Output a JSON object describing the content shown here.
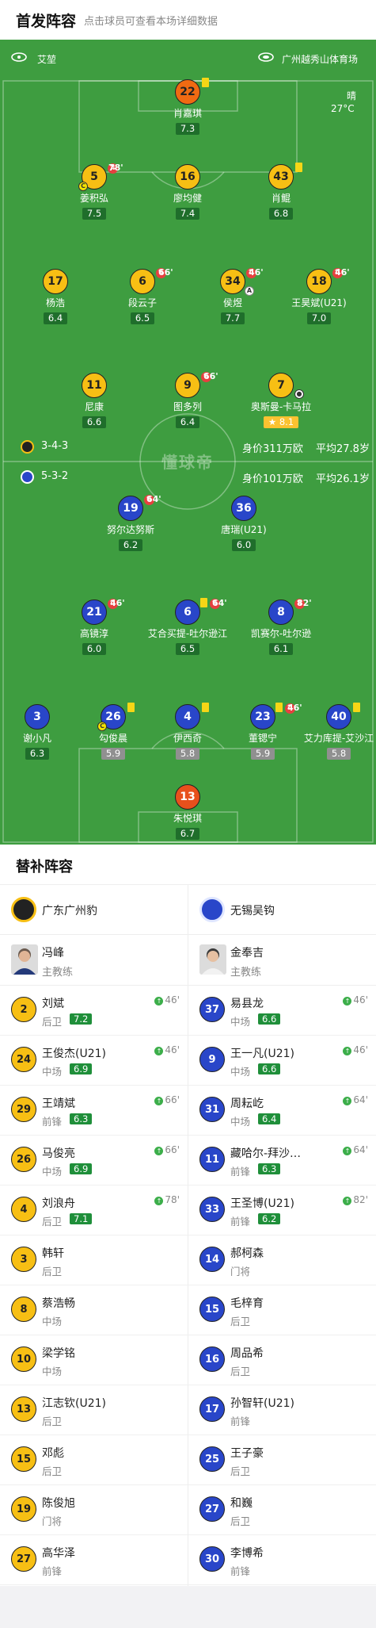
{
  "header": {
    "title": "首发阵容",
    "subtitle": "点击球员可查看本场详细数据"
  },
  "match": {
    "referee": "艾堃",
    "venue": "广州越秀山体育场",
    "weather": "晴",
    "temperature": "27°C"
  },
  "watermark": "懂球帝",
  "home_team": {
    "name": "广东广州豹",
    "formation": "3-4-3",
    "value": "身价311万欧",
    "avg_age": "平均27.8岁",
    "colors": {
      "kit": "#f7bf14",
      "gk": "#f06a12"
    },
    "players": [
      {
        "num": "22",
        "name": "肖嘉琪",
        "rating": "7.3",
        "events": [
          "yellow"
        ],
        "gk": true
      },
      {
        "num": "5",
        "name": "姜积弘",
        "rating": "7.5",
        "sub_time": "78'",
        "captain": true
      },
      {
        "num": "16",
        "name": "廖均健",
        "rating": "7.4"
      },
      {
        "num": "43",
        "name": "肖鲲",
        "rating": "6.8",
        "events": [
          "yellow"
        ]
      },
      {
        "num": "17",
        "name": "杨浩",
        "rating": "6.4"
      },
      {
        "num": "6",
        "name": "段云子",
        "rating": "6.5",
        "sub_time": "66'"
      },
      {
        "num": "34",
        "name": "侯煜",
        "rating": "7.7",
        "sub_time": "46'",
        "assist": true
      },
      {
        "num": "18",
        "name": "王昊斌(U21)",
        "rating": "7.0",
        "sub_time": "46'"
      },
      {
        "num": "11",
        "name": "尼康",
        "rating": "6.6"
      },
      {
        "num": "9",
        "name": "图多列",
        "rating": "6.4",
        "sub_time": "66'"
      },
      {
        "num": "7",
        "name": "奥斯曼-卡马拉",
        "rating": "8.1",
        "goal": true,
        "star": true
      }
    ]
  },
  "away_team": {
    "name": "无锡吴钩",
    "formation": "5-3-2",
    "value": "身价101万欧",
    "avg_age": "平均26.1岁",
    "colors": {
      "kit": "#2946c9"
    },
    "players": [
      {
        "num": "19",
        "name": "努尔达努斯",
        "rating": "6.2",
        "sub_time": "64'"
      },
      {
        "num": "36",
        "name": "唐瑞(U21)",
        "rating": "6.0"
      },
      {
        "num": "21",
        "name": "高镜淳",
        "rating": "6.0",
        "sub_time": "46'"
      },
      {
        "num": "6",
        "name": "艾合买提-吐尔逊江",
        "rating": "6.5",
        "sub_time": "64'",
        "events": [
          "yellow"
        ]
      },
      {
        "num": "8",
        "name": "凯赛尔-吐尔逊",
        "rating": "6.1",
        "sub_time": "82'"
      },
      {
        "num": "3",
        "name": "谢小凡",
        "rating": "6.3"
      },
      {
        "num": "26",
        "name": "勾俊晨",
        "rating": "5.9",
        "captain": true,
        "events": [
          "yellow"
        ]
      },
      {
        "num": "4",
        "name": "伊西奇",
        "rating": "5.8",
        "events": [
          "yellow"
        ]
      },
      {
        "num": "23",
        "name": "董锶宁",
        "rating": "5.9",
        "sub_time": "46'",
        "events": [
          "yellow"
        ]
      },
      {
        "num": "40",
        "name": "艾力库提-艾沙江",
        "rating": "5.8",
        "events": [
          "yellow"
        ]
      },
      {
        "num": "13",
        "name": "朱悦琪",
        "rating": "6.7",
        "gk": true
      }
    ]
  },
  "subs": {
    "title": "替补阵容",
    "home": {
      "team_name": "广东广州豹",
      "coach": {
        "name": "冯峰",
        "role": "主教练"
      },
      "players": [
        {
          "num": "2",
          "name": "刘斌",
          "pos": "后卫",
          "rating": "7.2",
          "in": "46'"
        },
        {
          "num": "24",
          "name": "王俊杰(U21)",
          "pos": "中场",
          "rating": "6.9",
          "in": "46'"
        },
        {
          "num": "29",
          "name": "王靖斌",
          "pos": "前锋",
          "rating": "6.3",
          "in": "66'"
        },
        {
          "num": "26",
          "name": "马俊亮",
          "pos": "中场",
          "rating": "6.9",
          "in": "66'"
        },
        {
          "num": "4",
          "name": "刘浪舟",
          "pos": "后卫",
          "rating": "7.1",
          "in": "78'"
        },
        {
          "num": "3",
          "name": "韩轩",
          "pos": "后卫"
        },
        {
          "num": "8",
          "name": "蔡浩畅",
          "pos": "中场"
        },
        {
          "num": "10",
          "name": "梁学铭",
          "pos": "中场"
        },
        {
          "num": "13",
          "name": "江志钦(U21)",
          "pos": "后卫"
        },
        {
          "num": "15",
          "name": "邓彪",
          "pos": "后卫"
        },
        {
          "num": "19",
          "name": "陈俊旭",
          "pos": "门将"
        },
        {
          "num": "27",
          "name": "高华泽",
          "pos": "前锋"
        }
      ]
    },
    "away": {
      "team_name": "无锡吴钩",
      "coach": {
        "name": "金奉吉",
        "role": "主教练"
      },
      "players": [
        {
          "num": "37",
          "name": "易县龙",
          "pos": "中场",
          "rating": "6.6",
          "in": "46'"
        },
        {
          "num": "9",
          "name": "王一凡(U21)",
          "pos": "中场",
          "rating": "6.6",
          "in": "46'"
        },
        {
          "num": "31",
          "name": "周耘屹",
          "pos": "中场",
          "rating": "6.4",
          "in": "64'"
        },
        {
          "num": "11",
          "name": "藏哈尔-拜沙…",
          "pos": "前锋",
          "rating": "6.3",
          "in": "64'"
        },
        {
          "num": "33",
          "name": "王圣博(U21)",
          "pos": "前锋",
          "rating": "6.2",
          "in": "82'"
        },
        {
          "num": "14",
          "name": "郝柯森",
          "pos": "门将"
        },
        {
          "num": "15",
          "name": "毛梓育",
          "pos": "后卫"
        },
        {
          "num": "16",
          "name": "周品希",
          "pos": "后卫"
        },
        {
          "num": "17",
          "name": "孙智轩(U21)",
          "pos": "前锋"
        },
        {
          "num": "25",
          "name": "王子豪",
          "pos": "后卫"
        },
        {
          "num": "27",
          "name": "和巍",
          "pos": "后卫"
        },
        {
          "num": "30",
          "name": "李博希",
          "pos": "前锋"
        }
      ]
    }
  }
}
